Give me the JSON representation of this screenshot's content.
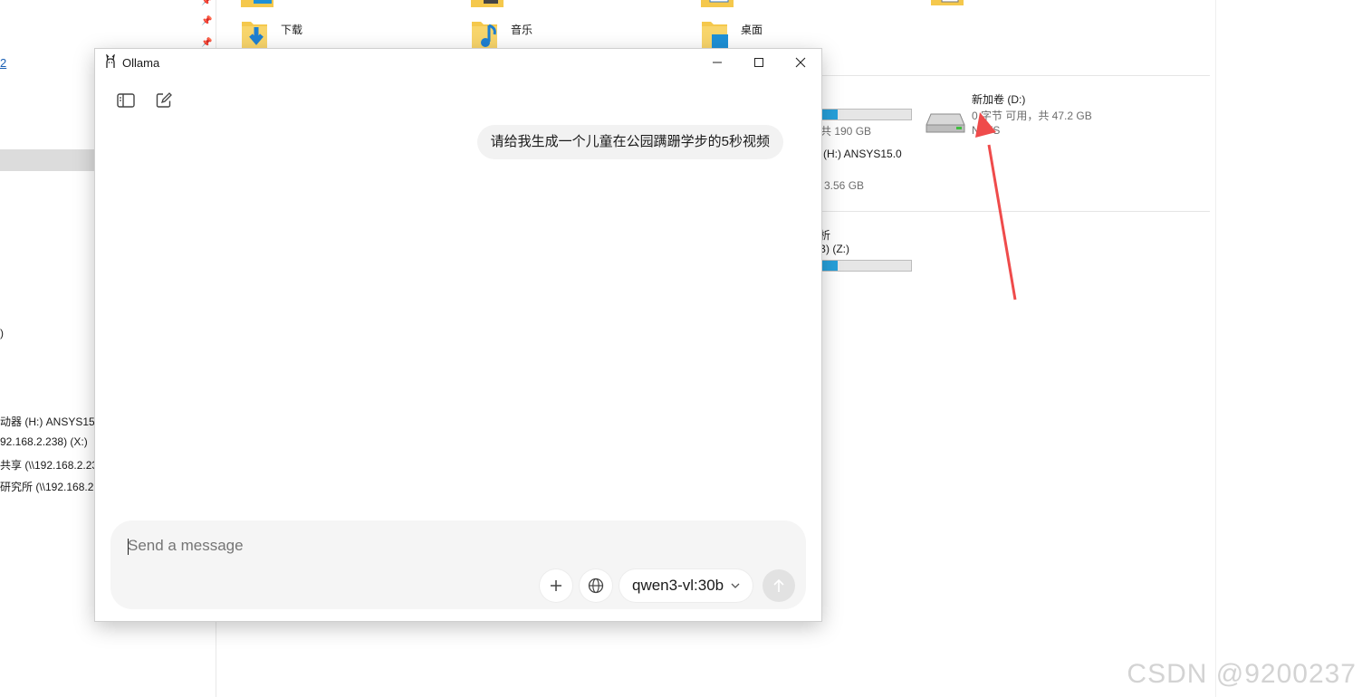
{
  "explorer": {
    "nav_link": "2",
    "nav_items": [
      ")",
      "动器 (H:) ANSYS15",
      "92.168.2.238) (X:)",
      "共享 (\\\\192.168.2.23",
      "研究所 (\\\\192.168.2."
    ],
    "folders": [
      {
        "name": "下载",
        "icon": "download-folder-icon"
      },
      {
        "name": "音乐",
        "icon": "music-folder-icon"
      },
      {
        "name": "桌面",
        "icon": "desktop-folder-icon"
      }
    ],
    "drives": {
      "c_capacity": "共 190 GB",
      "c_used_fraction": 0.35,
      "d_name": "新加卷 (D:)",
      "d_space": "0 字节 可用，共 47.2 GB",
      "d_fs": "NTFS",
      "h_name": "(H:) ANSYS15.0",
      "h_size": "3.56 GB",
      "net_name": "析",
      "net_drive": "B) (Z:)",
      "z_used_fraction": 0.35
    },
    "accent_color": "#26a0da"
  },
  "ollama": {
    "title": "Ollama",
    "user_message": "请给我生成一个儿童在公园蹒跚学步的5秒视频",
    "input_placeholder": "Send a message",
    "model": "qwen3-vl:30b"
  },
  "annotation": {
    "arrow_color": "#ef4b4b"
  },
  "watermark": "CSDN @9200237"
}
